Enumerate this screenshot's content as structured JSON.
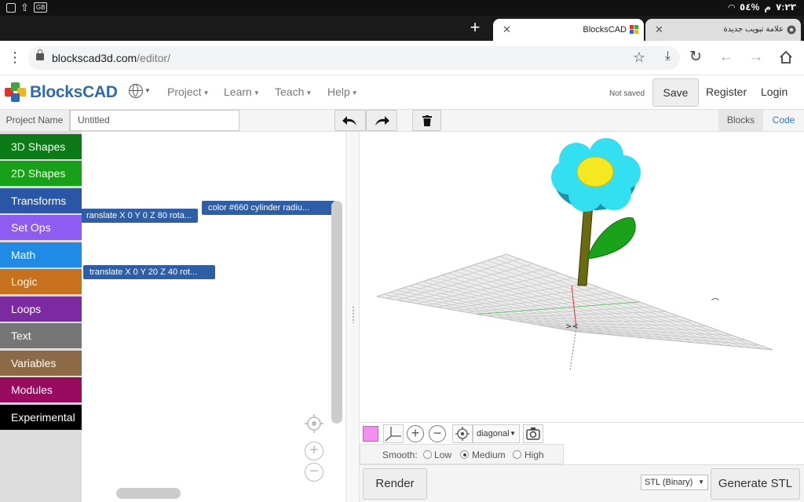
{
  "status_bar": {
    "time": "٧:٢٣",
    "period": "م",
    "battery": "٥٤%",
    "badge": "GB"
  },
  "tabs": [
    {
      "title": "BlocksCAD",
      "active": true
    },
    {
      "title": "علامة تبويب جديدة",
      "active": false
    }
  ],
  "toolbar": {
    "url_host": "blockscad3d.com",
    "url_path": "/editor/"
  },
  "navbar": {
    "logo": "BlocksCAD",
    "menus": [
      "Project",
      "Learn",
      "Teach",
      "Help"
    ],
    "save_status": "Not saved",
    "save": "Save",
    "register": "Register",
    "login": "Login"
  },
  "project": {
    "label": "Project Name",
    "name": "Untitled",
    "views": [
      "Blocks",
      "Code"
    ],
    "active_view": "Blocks"
  },
  "toolbox": [
    {
      "label": "3D Shapes",
      "color": "#0b7a17"
    },
    {
      "label": "2D Shapes",
      "color": "#19a019"
    },
    {
      "label": "Transforms",
      "color": "#2a56a6"
    },
    {
      "label": "Set Ops",
      "color": "#8e5cf3"
    },
    {
      "label": "Math",
      "color": "#1f8be6"
    },
    {
      "label": "Logic",
      "color": "#c7701d"
    },
    {
      "label": "Loops",
      "color": "#7b2aa2"
    },
    {
      "label": "Text",
      "color": "#767676"
    },
    {
      "label": "Variables",
      "color": "#8b6a45"
    },
    {
      "label": "Modules",
      "color": "#980a5d"
    },
    {
      "label": "Experimental",
      "color": "#000000"
    }
  ],
  "blocks": [
    {
      "text": "ranslate X 0 Y 0 Z 80 rota..."
    },
    {
      "text": "color #660 cylinder  radiu..."
    },
    {
      "text": "translate X 0 Y 20 Z 40 rot..."
    }
  ],
  "viewer": {
    "part_color": "#f48ef0",
    "view_mode": "diagonal",
    "smooth_label": "Smooth:",
    "smooth_options": [
      "Low",
      "Medium",
      "High"
    ],
    "smooth_selected": "Medium",
    "render": "Render",
    "export_format": "STL (Binary)",
    "generate": "Generate STL"
  }
}
